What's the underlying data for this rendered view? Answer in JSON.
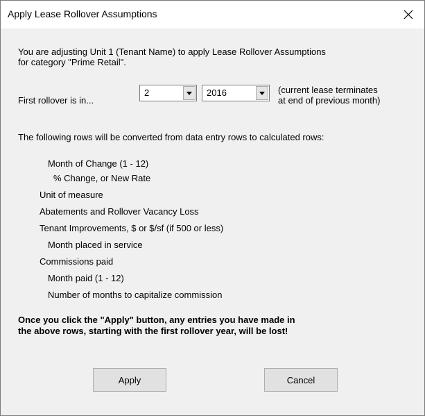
{
  "window": {
    "title": "Apply Lease Rollover Assumptions",
    "close_icon": "close-icon"
  },
  "intro": {
    "line1": "You are adjusting Unit 1 (Tenant Name) to apply Lease Rollover Assumptions",
    "line2": "for category \"Prime Retail\"."
  },
  "rollover": {
    "label": "First rollover is in...",
    "month": {
      "value": "2"
    },
    "year": {
      "value": "2016"
    },
    "note_line1": "(current lease terminates",
    "note_line2": "at end of previous month)"
  },
  "rows_header": "The following rows will be converted from data entry rows to calculated rows:",
  "rows": [
    "Month of Change (1 - 12)",
    "% Change, or New Rate",
    "Unit of measure",
    "Abatements and Rollover Vacancy Loss",
    "Tenant Improvements, $ or $/sf (if 500 or less)",
    "Month placed in service",
    "Commissions paid",
    "Month paid (1 - 12)",
    "Number of months to capitalize commission"
  ],
  "warning": {
    "line1": "Once you click the \"Apply\" button, any entries you have made in",
    "line2": "the above rows, starting with the first rollover year, will be lost!"
  },
  "buttons": {
    "apply": "Apply",
    "cancel": "Cancel"
  }
}
